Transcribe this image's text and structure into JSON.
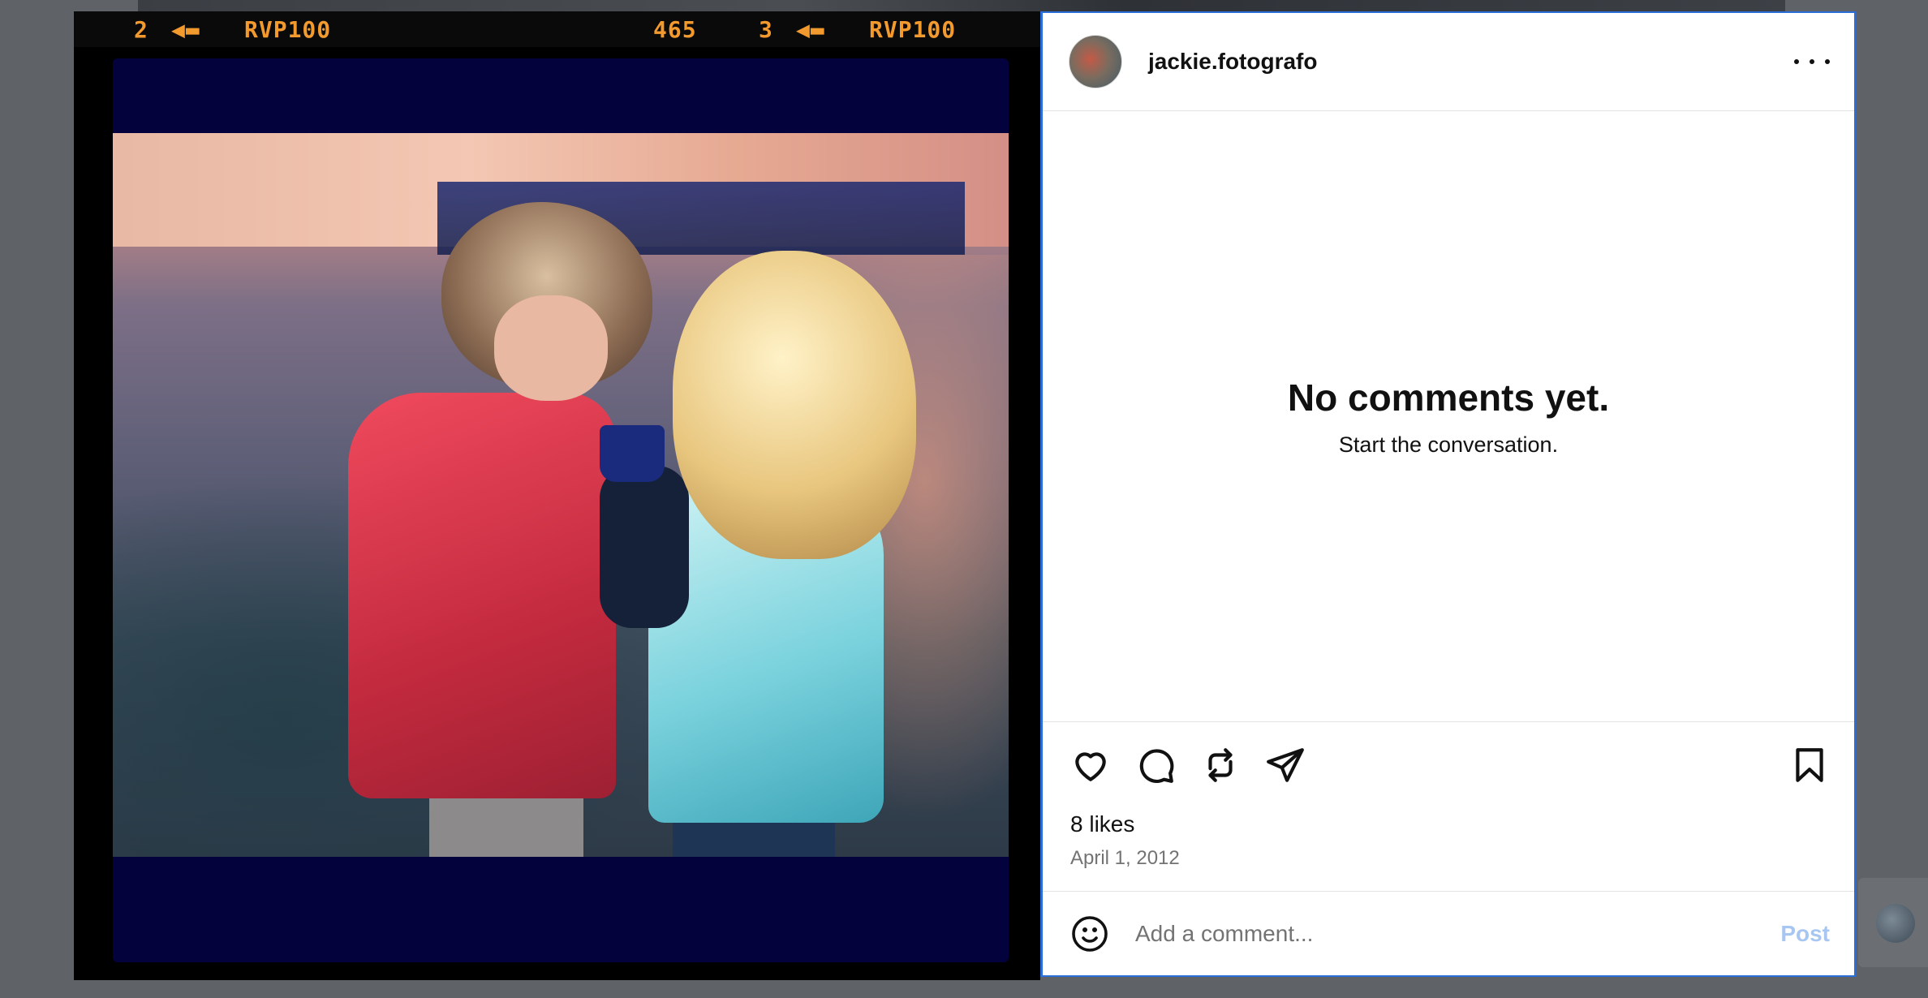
{
  "film_strip": {
    "left_frame": "2",
    "left_label": "RVP100",
    "counter": "465",
    "right_frame": "3",
    "right_label": "RVP100"
  },
  "post": {
    "username": "jackie.fotografo",
    "empty_title": "No comments yet.",
    "empty_subtitle": "Start the conversation.",
    "likes": "8 likes",
    "date": "April 1, 2012"
  },
  "comment": {
    "placeholder": "Add a comment...",
    "post_label": "Post"
  },
  "icons": [
    "more-icon",
    "heart-icon",
    "comment-icon",
    "repost-icon",
    "share-icon",
    "bookmark-icon",
    "emoji-icon"
  ],
  "colors": {
    "accent_border": "#2a6fd8",
    "post_button_disabled": "#a7c7f2",
    "film_text": "#f29a2e"
  }
}
